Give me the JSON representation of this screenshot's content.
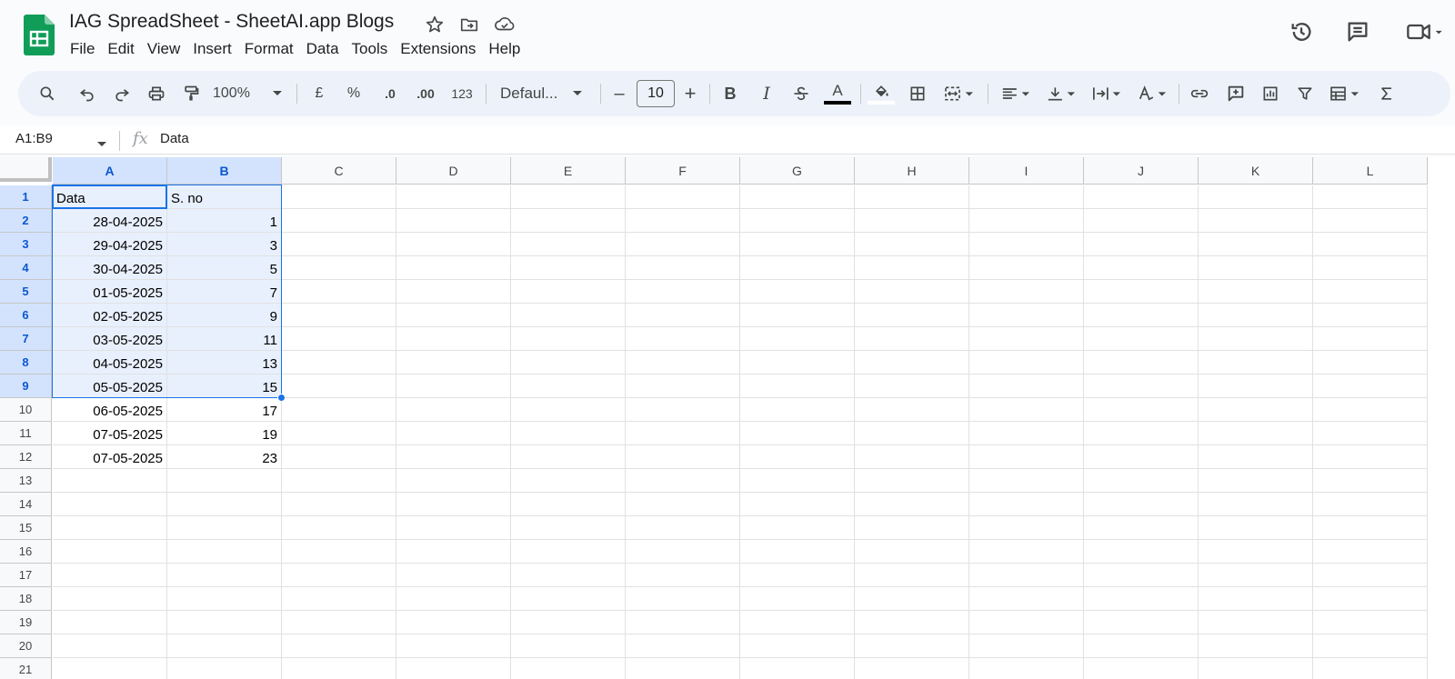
{
  "app": {
    "doc_title": "IAG SpreadSheet - SheetAI.app Blogs",
    "menus": [
      "File",
      "Edit",
      "View",
      "Insert",
      "Format",
      "Data",
      "Tools",
      "Extensions",
      "Help"
    ]
  },
  "toolbar": {
    "zoom": "100%",
    "currency": "£",
    "percent": "%",
    "decrease_decimal": ".0",
    "increase_decimal": ".00",
    "number_format": "123",
    "font": "Defaul...",
    "minus": "–",
    "font_size": "10",
    "plus": "+",
    "bold": "B",
    "italic": "I",
    "text_color_letter": "A",
    "accent_color": "#1a73e8"
  },
  "formula_bar": {
    "name_box": "A1:B9",
    "fx": "fx",
    "content": "Data"
  },
  "sheet": {
    "columns": [
      "A",
      "B",
      "C",
      "D",
      "E",
      "F",
      "G",
      "H",
      "I",
      "J",
      "K",
      "L"
    ],
    "row_numbers": [
      "1",
      "2",
      "3",
      "4",
      "5",
      "6",
      "7",
      "8",
      "9",
      "10",
      "11",
      "12",
      "13",
      "14",
      "15",
      "16",
      "17",
      "18",
      "19",
      "20",
      "21"
    ],
    "cells": [
      [
        "Data",
        "S. no"
      ],
      [
        "28-04-2025",
        "1"
      ],
      [
        "29-04-2025",
        "3"
      ],
      [
        "30-04-2025",
        "5"
      ],
      [
        "01-05-2025",
        "7"
      ],
      [
        "02-05-2025",
        "9"
      ],
      [
        "03-05-2025",
        "11"
      ],
      [
        "04-05-2025",
        "13"
      ],
      [
        "05-05-2025",
        "15"
      ],
      [
        "06-05-2025",
        "17"
      ],
      [
        "07-05-2025",
        "19"
      ],
      [
        "07-05-2025",
        "23"
      ]
    ],
    "selection": "A1:B9"
  }
}
